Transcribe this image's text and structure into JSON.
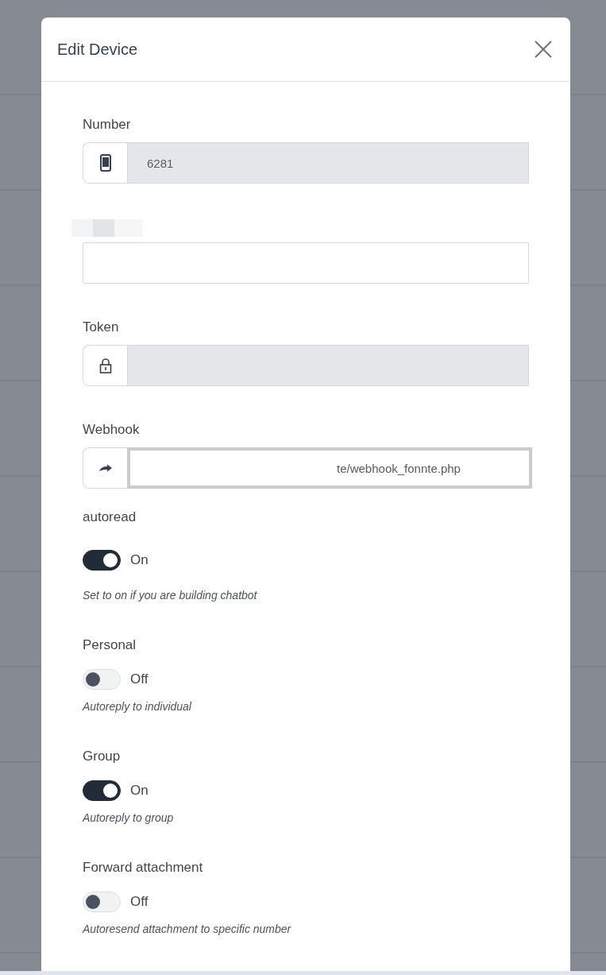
{
  "dialog": {
    "title": "Edit Device"
  },
  "fields": [
    {
      "kind": "phone",
      "label": "Number",
      "value": "6281",
      "readonly": true,
      "focused": false
    },
    {
      "kind": "plain",
      "readonly": false,
      "focused": false
    },
    {
      "kind": "lock",
      "label": "Token",
      "readonly": true,
      "focused": false
    },
    {
      "kind": "share",
      "label": "Webhook",
      "value": "te/webhook_fonnte.php",
      "readonly": false,
      "focused": true
    }
  ],
  "toggles": [
    {
      "label": "autoread",
      "on": true,
      "state_text": "On",
      "help": "Set to on if you are building chatbot"
    },
    {
      "label": "Personal",
      "on": false,
      "state_text": "Off",
      "help": "Autoreply to individual"
    },
    {
      "label": "Group",
      "on": true,
      "state_text": "On",
      "help": "Autoreply to group"
    },
    {
      "label": "Forward attachment",
      "on": false,
      "state_text": "Off",
      "help": "Autoresend attachment to specific number"
    }
  ]
}
